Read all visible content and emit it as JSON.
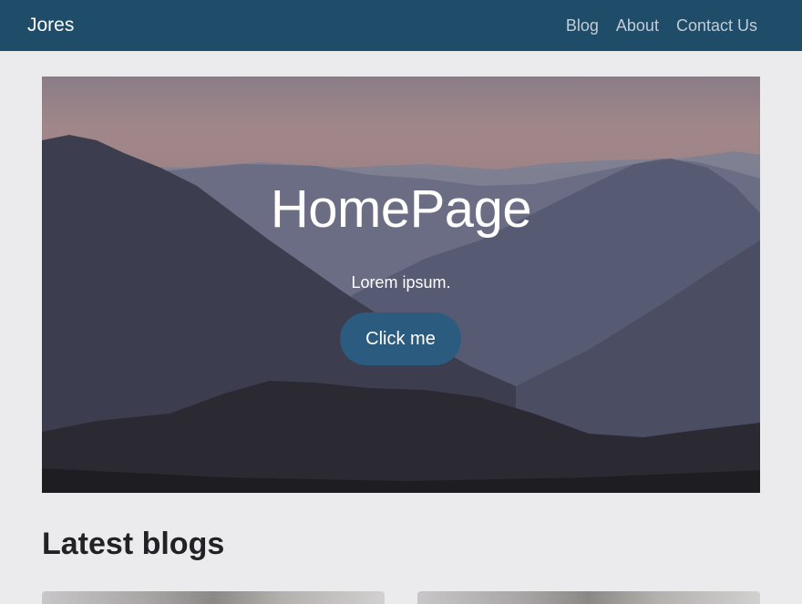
{
  "navbar": {
    "brand": "Jores",
    "links": [
      "Blog",
      "About",
      "Contact Us"
    ]
  },
  "hero": {
    "title": "HomePage",
    "subtitle": "Lorem ipsum.",
    "button_label": "Click me"
  },
  "blogs": {
    "heading": "Latest blogs",
    "cards": [
      {
        "image": "blog-thumbnail-1"
      },
      {
        "image": "blog-thumbnail-2"
      }
    ]
  },
  "colors": {
    "navbar_bg": "#1f4c69",
    "button_bg": "#2b5c80",
    "page_bg": "#ebeaec"
  }
}
